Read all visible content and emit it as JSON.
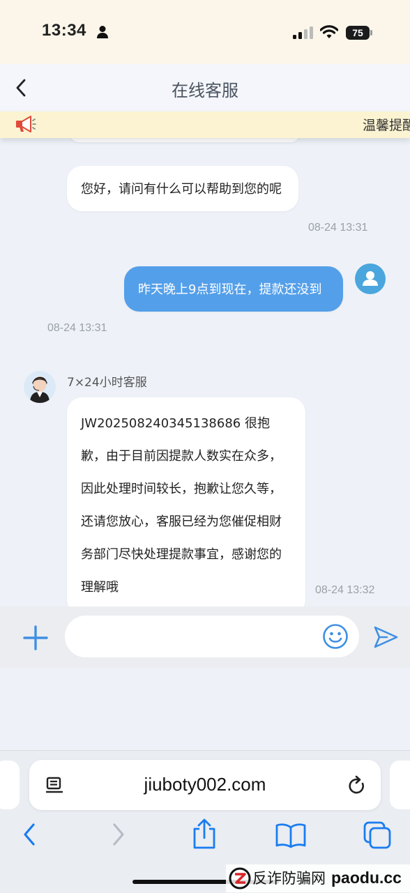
{
  "status_bar": {
    "time": "13:34",
    "battery": "75"
  },
  "header": {
    "title": "在线客服"
  },
  "notice": {
    "text": "温馨提醒"
  },
  "messages": [
    {
      "sender": "agent",
      "text": "您好，请问有什么可以帮助到您的呢",
      "time": "08-24 13:31"
    },
    {
      "sender": "user",
      "text": "昨天晚上9点到现在，提款还没到",
      "time": "08-24 13:31"
    },
    {
      "sender": "agent",
      "agent_name": "7×24小时客服",
      "text": "JW202508240345138686  很抱歉，由于目前因提款人数实在众多，因此处理时间较长，抱歉让您久等，还请您放心，客服已经为您催促相财务部门尽快处理提款事宜，感谢您的理解哦",
      "time": "08-24 13:32"
    }
  ],
  "input_bar": {
    "value": "",
    "placeholder": ""
  },
  "browser": {
    "url": "jiuboty002.com"
  },
  "watermark": {
    "text": "反诈防骗网",
    "domain": "paodu.cc"
  },
  "colors": {
    "accent": "#549fe9",
    "user_bubble": "#549fe9",
    "ios_blue": "#1a7cf0",
    "notice_bg": "#fbf3d1"
  },
  "icons": {
    "back": "chevron-left-icon",
    "notice": "megaphone-icon",
    "add": "plus-icon",
    "emoji": "smiley-icon",
    "send": "paper-plane-icon"
  }
}
